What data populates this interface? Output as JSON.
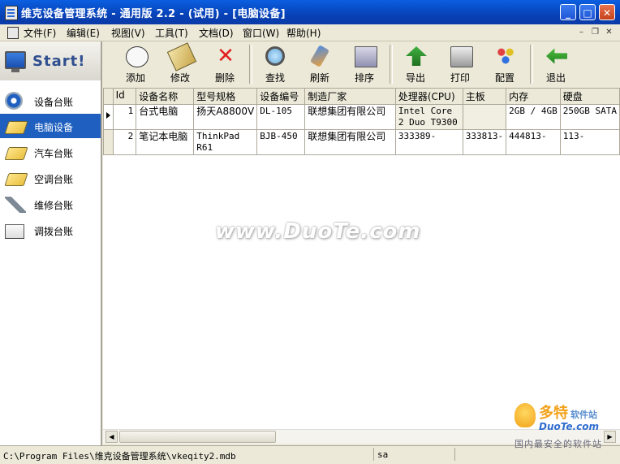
{
  "window": {
    "title": "维克设备管理系统 - 通用版 2.2 - (试用) - [电脑设备]"
  },
  "menu": [
    "文件(F)",
    "编辑(E)",
    "视图(V)",
    "工具(T)",
    "文档(D)",
    "窗口(W)",
    "帮助(H)"
  ],
  "sidebar": {
    "start_label": "Start!",
    "items": [
      {
        "label": "设备台账",
        "icon": "gear-icon"
      },
      {
        "label": "电脑设备",
        "icon": "book-icon",
        "active": true
      },
      {
        "label": "汽车台账",
        "icon": "book-icon"
      },
      {
        "label": "空调台账",
        "icon": "book-icon"
      },
      {
        "label": "维修台账",
        "icon": "wrench-icon"
      },
      {
        "label": "调拨台账",
        "icon": "transfer-icon"
      }
    ]
  },
  "toolbar": {
    "add": "添加",
    "edit": "修改",
    "delete": "删除",
    "find": "查找",
    "refresh": "刷新",
    "sort": "排序",
    "export": "导出",
    "print": "打印",
    "config": "配置",
    "exit": "退出"
  },
  "grid": {
    "columns": [
      "Id",
      "设备名称",
      "型号规格",
      "设备编号",
      "制造厂家",
      "处理器(CPU)",
      "主板",
      "内存",
      "硬盘"
    ],
    "rows": [
      [
        "1",
        "台式电脑",
        "扬天A8800V",
        "DL-105",
        "联想集团有限公司",
        "Intel Core 2 Duo T9300",
        "",
        "2GB / 4GB",
        "250GB SATA"
      ],
      [
        "2",
        "笔记本电脑",
        "ThinkPad R61",
        "BJB-450",
        "联想集团有限公司",
        "333389-",
        "333813-",
        "444813-",
        "113-"
      ]
    ]
  },
  "status": {
    "path": "C:\\Program Files\\维克设备管理系统\\vkeqity2.mdb",
    "user": "sa"
  },
  "watermarks": {
    "center": "www.DuoTe.com",
    "logo_main": "多特",
    "logo_sub": "软件站",
    "logo_url": "DuoTe.com",
    "logo_slogan": "国内最安全的软件站"
  }
}
